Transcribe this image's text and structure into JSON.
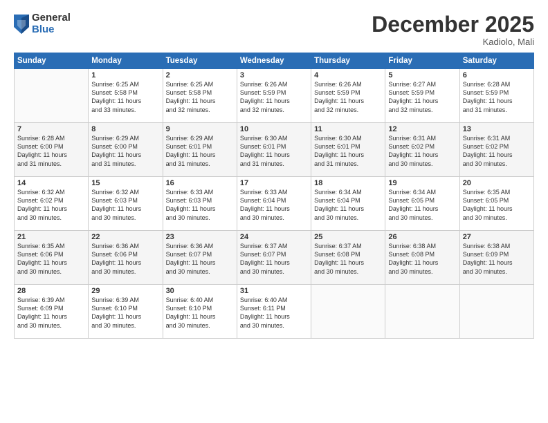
{
  "logo": {
    "general": "General",
    "blue": "Blue"
  },
  "title": "December 2025",
  "subtitle": "Kadiolo, Mali",
  "headers": [
    "Sunday",
    "Monday",
    "Tuesday",
    "Wednesday",
    "Thursday",
    "Friday",
    "Saturday"
  ],
  "weeks": [
    [
      {
        "day": "",
        "text": ""
      },
      {
        "day": "1",
        "text": "Sunrise: 6:25 AM\nSunset: 5:58 PM\nDaylight: 11 hours\nand 33 minutes."
      },
      {
        "day": "2",
        "text": "Sunrise: 6:25 AM\nSunset: 5:58 PM\nDaylight: 11 hours\nand 32 minutes."
      },
      {
        "day": "3",
        "text": "Sunrise: 6:26 AM\nSunset: 5:59 PM\nDaylight: 11 hours\nand 32 minutes."
      },
      {
        "day": "4",
        "text": "Sunrise: 6:26 AM\nSunset: 5:59 PM\nDaylight: 11 hours\nand 32 minutes."
      },
      {
        "day": "5",
        "text": "Sunrise: 6:27 AM\nSunset: 5:59 PM\nDaylight: 11 hours\nand 32 minutes."
      },
      {
        "day": "6",
        "text": "Sunrise: 6:28 AM\nSunset: 5:59 PM\nDaylight: 11 hours\nand 31 minutes."
      }
    ],
    [
      {
        "day": "7",
        "text": "Sunrise: 6:28 AM\nSunset: 6:00 PM\nDaylight: 11 hours\nand 31 minutes."
      },
      {
        "day": "8",
        "text": "Sunrise: 6:29 AM\nSunset: 6:00 PM\nDaylight: 11 hours\nand 31 minutes."
      },
      {
        "day": "9",
        "text": "Sunrise: 6:29 AM\nSunset: 6:01 PM\nDaylight: 11 hours\nand 31 minutes."
      },
      {
        "day": "10",
        "text": "Sunrise: 6:30 AM\nSunset: 6:01 PM\nDaylight: 11 hours\nand 31 minutes."
      },
      {
        "day": "11",
        "text": "Sunrise: 6:30 AM\nSunset: 6:01 PM\nDaylight: 11 hours\nand 31 minutes."
      },
      {
        "day": "12",
        "text": "Sunrise: 6:31 AM\nSunset: 6:02 PM\nDaylight: 11 hours\nand 30 minutes."
      },
      {
        "day": "13",
        "text": "Sunrise: 6:31 AM\nSunset: 6:02 PM\nDaylight: 11 hours\nand 30 minutes."
      }
    ],
    [
      {
        "day": "14",
        "text": "Sunrise: 6:32 AM\nSunset: 6:02 PM\nDaylight: 11 hours\nand 30 minutes."
      },
      {
        "day": "15",
        "text": "Sunrise: 6:32 AM\nSunset: 6:03 PM\nDaylight: 11 hours\nand 30 minutes."
      },
      {
        "day": "16",
        "text": "Sunrise: 6:33 AM\nSunset: 6:03 PM\nDaylight: 11 hours\nand 30 minutes."
      },
      {
        "day": "17",
        "text": "Sunrise: 6:33 AM\nSunset: 6:04 PM\nDaylight: 11 hours\nand 30 minutes."
      },
      {
        "day": "18",
        "text": "Sunrise: 6:34 AM\nSunset: 6:04 PM\nDaylight: 11 hours\nand 30 minutes."
      },
      {
        "day": "19",
        "text": "Sunrise: 6:34 AM\nSunset: 6:05 PM\nDaylight: 11 hours\nand 30 minutes."
      },
      {
        "day": "20",
        "text": "Sunrise: 6:35 AM\nSunset: 6:05 PM\nDaylight: 11 hours\nand 30 minutes."
      }
    ],
    [
      {
        "day": "21",
        "text": "Sunrise: 6:35 AM\nSunset: 6:06 PM\nDaylight: 11 hours\nand 30 minutes."
      },
      {
        "day": "22",
        "text": "Sunrise: 6:36 AM\nSunset: 6:06 PM\nDaylight: 11 hours\nand 30 minutes."
      },
      {
        "day": "23",
        "text": "Sunrise: 6:36 AM\nSunset: 6:07 PM\nDaylight: 11 hours\nand 30 minutes."
      },
      {
        "day": "24",
        "text": "Sunrise: 6:37 AM\nSunset: 6:07 PM\nDaylight: 11 hours\nand 30 minutes."
      },
      {
        "day": "25",
        "text": "Sunrise: 6:37 AM\nSunset: 6:08 PM\nDaylight: 11 hours\nand 30 minutes."
      },
      {
        "day": "26",
        "text": "Sunrise: 6:38 AM\nSunset: 6:08 PM\nDaylight: 11 hours\nand 30 minutes."
      },
      {
        "day": "27",
        "text": "Sunrise: 6:38 AM\nSunset: 6:09 PM\nDaylight: 11 hours\nand 30 minutes."
      }
    ],
    [
      {
        "day": "28",
        "text": "Sunrise: 6:39 AM\nSunset: 6:09 PM\nDaylight: 11 hours\nand 30 minutes."
      },
      {
        "day": "29",
        "text": "Sunrise: 6:39 AM\nSunset: 6:10 PM\nDaylight: 11 hours\nand 30 minutes."
      },
      {
        "day": "30",
        "text": "Sunrise: 6:40 AM\nSunset: 6:10 PM\nDaylight: 11 hours\nand 30 minutes."
      },
      {
        "day": "31",
        "text": "Sunrise: 6:40 AM\nSunset: 6:11 PM\nDaylight: 11 hours\nand 30 minutes."
      },
      {
        "day": "",
        "text": ""
      },
      {
        "day": "",
        "text": ""
      },
      {
        "day": "",
        "text": ""
      }
    ]
  ]
}
